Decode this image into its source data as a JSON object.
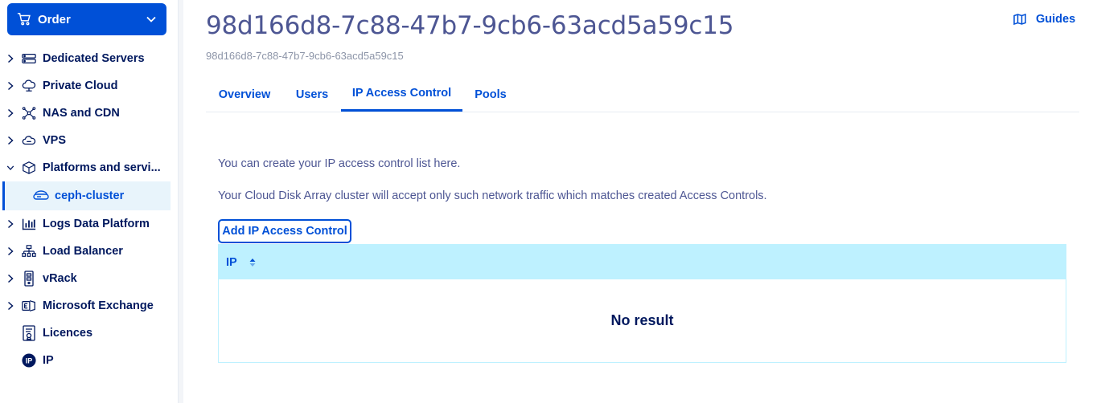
{
  "sidebar": {
    "order_label": "Order",
    "items": [
      {
        "label": "Dedicated Servers",
        "icon": "server-icon"
      },
      {
        "label": "Private Cloud",
        "icon": "cloud-network-icon"
      },
      {
        "label": "NAS and CDN",
        "icon": "nas-network-icon"
      },
      {
        "label": "VPS",
        "icon": "vps-cloud-icon"
      },
      {
        "label": "Platforms and servi...",
        "icon": "platforms-box-icon"
      },
      {
        "label": "ceph-cluster",
        "icon": "disk-cluster-icon"
      },
      {
        "label": "Logs Data Platform",
        "icon": "chart-bars-icon"
      },
      {
        "label": "Load Balancer",
        "icon": "load-balancer-icon"
      },
      {
        "label": "vRack",
        "icon": "vrack-icon"
      },
      {
        "label": "Microsoft Exchange",
        "icon": "exchange-icon"
      },
      {
        "label": "Licences",
        "icon": "licence-icon"
      },
      {
        "label": "IP",
        "icon": "ip-icon"
      }
    ]
  },
  "header": {
    "title": "98d166d8-7c88-47b7-9cb6-63acd5a59c15",
    "subtitle": "98d166d8-7c88-47b7-9cb6-63acd5a59c15",
    "guides_label": "Guides"
  },
  "tabs": [
    {
      "label": "Overview"
    },
    {
      "label": "Users"
    },
    {
      "label": "IP Access Control"
    },
    {
      "label": "Pools"
    }
  ],
  "active_tab": "IP Access Control",
  "content": {
    "info_line_1": "You can create your IP access control list here.",
    "info_line_2": "Your Cloud Disk Array cluster will accept only such network traffic which matches created Access Controls.",
    "add_button_label": "Add IP Access Control",
    "table": {
      "columns": [
        "IP"
      ],
      "empty_message": "No result"
    }
  },
  "colors": {
    "primary": "#0050d7",
    "text_dark": "#00185e",
    "text_muted": "#4d5693",
    "table_header_bg": "#bef1ff",
    "active_item_bg": "#e8f4fb"
  }
}
